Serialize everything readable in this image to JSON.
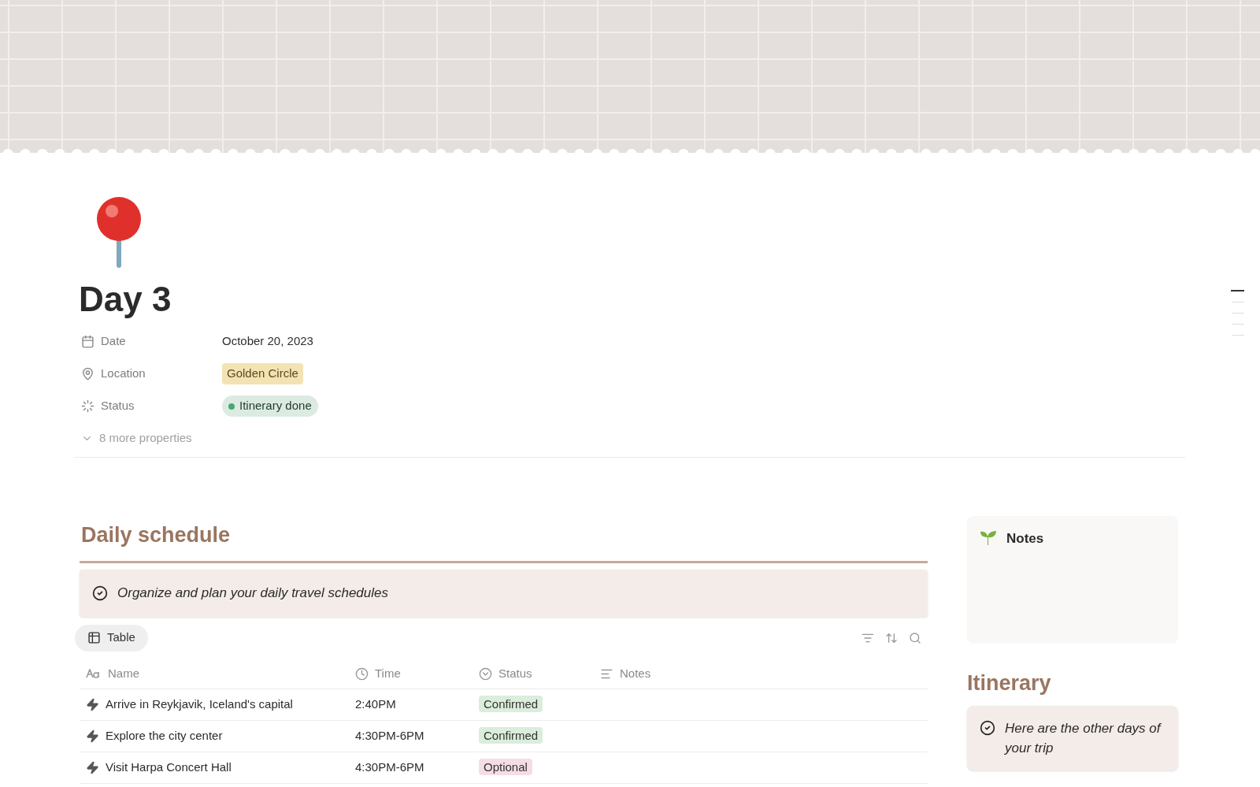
{
  "page": {
    "title": "Day 3"
  },
  "properties": [
    {
      "kind": "date",
      "label": "Date",
      "value": "October 20, 2023"
    },
    {
      "kind": "location",
      "label": "Location",
      "value": "Golden Circle",
      "color": "#f3e3b3"
    },
    {
      "kind": "status",
      "label": "Status",
      "value": "Itinerary done",
      "color": "#4aa577"
    }
  ],
  "more_properties": "8 more properties",
  "schedule": {
    "heading": "Daily schedule",
    "callout": "Organize and plan your daily travel schedules",
    "view_tab": {
      "label": "Table",
      "selected": true
    },
    "columns": [
      {
        "kind": "title",
        "label": "Name"
      },
      {
        "kind": "time",
        "label": "Time"
      },
      {
        "kind": "status",
        "label": "Status"
      },
      {
        "kind": "text",
        "label": "Notes"
      }
    ],
    "rows": [
      {
        "name": "Arrive in Reykjavik, Iceland's capital",
        "time": "2:40PM",
        "status": "Confirmed",
        "color": "#dbeddb"
      },
      {
        "name": "Explore the city center",
        "time": "4:30PM-6PM",
        "status": "Confirmed",
        "color": "#dbeddb"
      },
      {
        "name": "Visit Harpa Concert Hall",
        "time": "4:30PM-6PM",
        "status": "Optional",
        "color": "#f5dde6"
      }
    ]
  },
  "notes": {
    "title": "Notes"
  },
  "itinerary": {
    "heading": "Itinerary",
    "callout": "Here are the other days of your trip"
  }
}
